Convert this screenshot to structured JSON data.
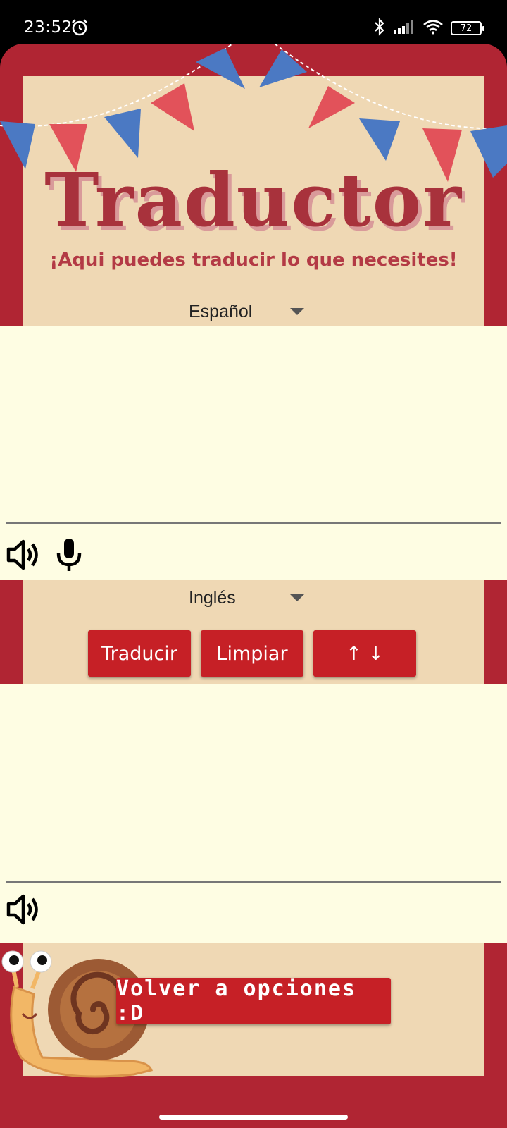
{
  "status_bar": {
    "time": "23:52",
    "battery": "72",
    "icons": [
      "alarm-icon",
      "bluetooth-icon",
      "signal-icon",
      "wifi-icon",
      "battery-icon"
    ]
  },
  "header": {
    "title": "Traductor",
    "subtitle": "¡Aqui puedes traducir lo que necesites!"
  },
  "source": {
    "language": "Español",
    "text": "",
    "icons": [
      "speaker-icon",
      "microphone-icon"
    ]
  },
  "target": {
    "language": "Inglés",
    "text": "",
    "icons": [
      "speaker-icon"
    ]
  },
  "actions": {
    "translate_label": "Traducir",
    "clear_label": "Limpiar",
    "swap_label": "↑ ↓"
  },
  "footer": {
    "back_label": "Volver a opciones :D"
  },
  "colors": {
    "frame": "#b02533",
    "poster": "#efd8b4",
    "panel": "#fefde3",
    "button": "#c62026",
    "title": "#a8323c"
  }
}
